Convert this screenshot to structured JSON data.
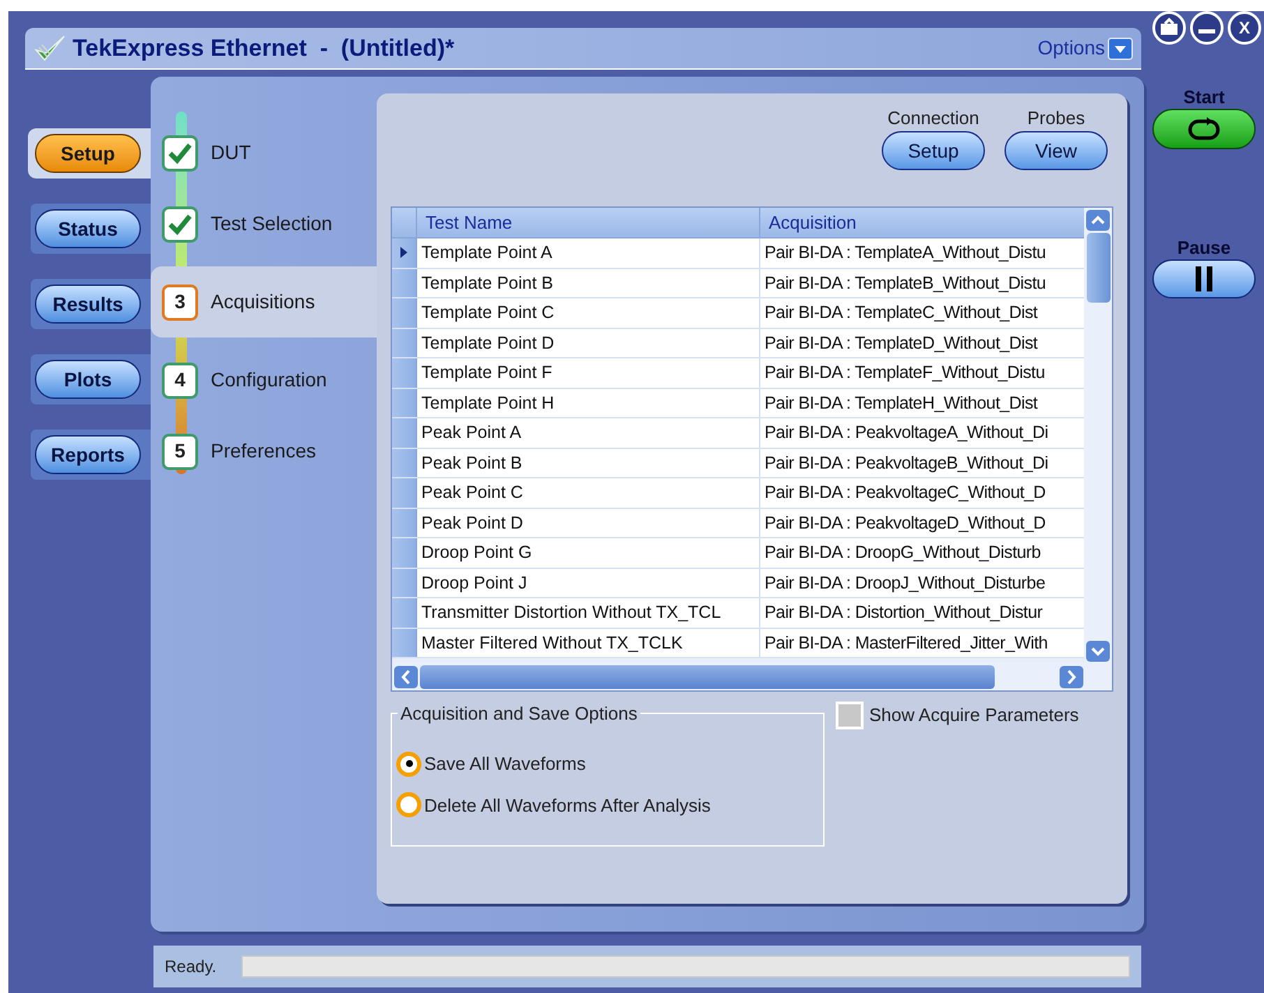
{
  "window": {
    "title": "TekExpress Ethernet  -  (Untitled)*",
    "options": "Options",
    "close": "X"
  },
  "nav": [
    {
      "label": "Setup",
      "selected": true
    },
    {
      "label": "Status",
      "selected": false
    },
    {
      "label": "Results",
      "selected": false
    },
    {
      "label": "Plots",
      "selected": false
    },
    {
      "label": "Reports",
      "selected": false
    }
  ],
  "steps": [
    {
      "label": "DUT",
      "done": true,
      "selected": false
    },
    {
      "label": "Test Selection",
      "done": true,
      "selected": false
    },
    {
      "number": "3",
      "label": "Acquisitions",
      "done": false,
      "selected": true
    },
    {
      "number": "4",
      "label": "Configuration",
      "done": false,
      "selected": false
    },
    {
      "number": "5",
      "label": "Preferences",
      "done": false,
      "selected": false
    }
  ],
  "header_buttons": [
    {
      "caption": "Connection",
      "label": "Setup"
    },
    {
      "caption": "Probes",
      "label": "View"
    }
  ],
  "table": {
    "columns": [
      "Test Name",
      "Acquisition"
    ],
    "rows": [
      {
        "test_name": "Template Point A",
        "acquisition": "Pair BI-DA : TemplateA_Without_Distu",
        "selected": true
      },
      {
        "test_name": "Template Point B",
        "acquisition": "Pair BI-DA : TemplateB_Without_Distu",
        "selected": false
      },
      {
        "test_name": "Template Point C",
        "acquisition": "Pair BI-DA : TemplateC_Without_Dist",
        "selected": false
      },
      {
        "test_name": "Template Point D",
        "acquisition": "Pair BI-DA : TemplateD_Without_Dist",
        "selected": false
      },
      {
        "test_name": "Template Point F",
        "acquisition": "Pair BI-DA : TemplateF_Without_Distu",
        "selected": false
      },
      {
        "test_name": "Template Point H",
        "acquisition": "Pair BI-DA : TemplateH_Without_Dist",
        "selected": false
      },
      {
        "test_name": "Peak Point A",
        "acquisition": "Pair BI-DA : PeakvoltageA_Without_Di",
        "selected": false
      },
      {
        "test_name": "Peak Point B",
        "acquisition": "Pair BI-DA : PeakvoltageB_Without_Di",
        "selected": false
      },
      {
        "test_name": "Peak Point C",
        "acquisition": "Pair BI-DA : PeakvoltageC_Without_D",
        "selected": false
      },
      {
        "test_name": "Peak Point D",
        "acquisition": "Pair BI-DA : PeakvoltageD_Without_D",
        "selected": false
      },
      {
        "test_name": "Droop Point G",
        "acquisition": "Pair BI-DA : DroopG_Without_Disturb",
        "selected": false
      },
      {
        "test_name": "Droop Point J",
        "acquisition": "Pair BI-DA : DroopJ_Without_Disturbe",
        "selected": false
      },
      {
        "test_name": "Transmitter Distortion Without TX_TCL",
        "acquisition": "Pair BI-DA : Distortion_Without_Distur",
        "selected": false
      },
      {
        "test_name": "Master Filtered Without TX_TCLK",
        "acquisition": "Pair BI-DA : MasterFiltered_Jitter_With",
        "selected": false
      }
    ]
  },
  "save_options": {
    "title": "Acquisition and Save Options",
    "options": [
      {
        "label": "Save All Waveforms",
        "selected": true
      },
      {
        "label": "Delete All Waveforms After Analysis",
        "selected": false
      }
    ]
  },
  "show_acquire_parameters": {
    "label": "Show Acquire Parameters",
    "checked": false
  },
  "run_controls": [
    {
      "label": "Start",
      "kind": "start"
    },
    {
      "label": "Pause",
      "kind": "pause"
    }
  ],
  "status_bar": {
    "text": "Ready.",
    "level": 0
  }
}
